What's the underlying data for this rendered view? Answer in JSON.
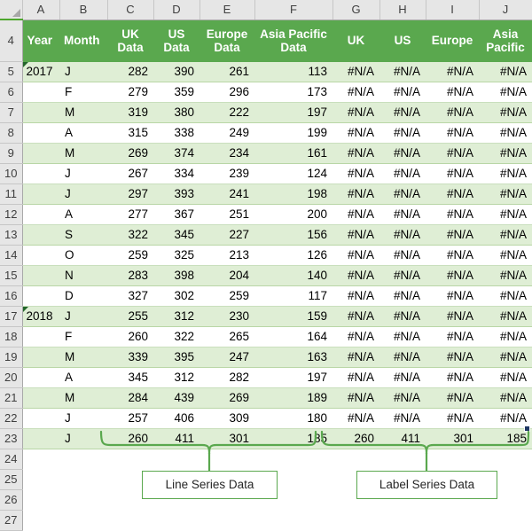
{
  "app": {
    "type": "spreadsheet",
    "column_headers": [
      "A",
      "B",
      "C",
      "D",
      "E",
      "F",
      "G",
      "H",
      "I",
      "J"
    ],
    "corner_icon": "select-all-triangle-icon"
  },
  "table": {
    "header_row_number": "4",
    "headers": [
      "Year",
      "Month",
      "UK Data",
      "US Data",
      "Europe Data",
      "Asia Pacific Data",
      "UK",
      "US",
      "Europe",
      "Asia Pacific"
    ],
    "rows": [
      {
        "row": "5",
        "year": "2017",
        "month": "J",
        "uk_data": "282",
        "us_data": "390",
        "europe_data": "261",
        "asia_data": "113",
        "uk": "#N/A",
        "us": "#N/A",
        "europe": "#N/A",
        "asia": "#N/A"
      },
      {
        "row": "6",
        "year": "",
        "month": "F",
        "uk_data": "279",
        "us_data": "359",
        "europe_data": "296",
        "asia_data": "173",
        "uk": "#N/A",
        "us": "#N/A",
        "europe": "#N/A",
        "asia": "#N/A"
      },
      {
        "row": "7",
        "year": "",
        "month": "M",
        "uk_data": "319",
        "us_data": "380",
        "europe_data": "222",
        "asia_data": "197",
        "uk": "#N/A",
        "us": "#N/A",
        "europe": "#N/A",
        "asia": "#N/A"
      },
      {
        "row": "8",
        "year": "",
        "month": "A",
        "uk_data": "315",
        "us_data": "338",
        "europe_data": "249",
        "asia_data": "199",
        "uk": "#N/A",
        "us": "#N/A",
        "europe": "#N/A",
        "asia": "#N/A"
      },
      {
        "row": "9",
        "year": "",
        "month": "M",
        "uk_data": "269",
        "us_data": "374",
        "europe_data": "234",
        "asia_data": "161",
        "uk": "#N/A",
        "us": "#N/A",
        "europe": "#N/A",
        "asia": "#N/A"
      },
      {
        "row": "10",
        "year": "",
        "month": "J",
        "uk_data": "267",
        "us_data": "334",
        "europe_data": "239",
        "asia_data": "124",
        "uk": "#N/A",
        "us": "#N/A",
        "europe": "#N/A",
        "asia": "#N/A"
      },
      {
        "row": "11",
        "year": "",
        "month": "J",
        "uk_data": "297",
        "us_data": "393",
        "europe_data": "241",
        "asia_data": "198",
        "uk": "#N/A",
        "us": "#N/A",
        "europe": "#N/A",
        "asia": "#N/A"
      },
      {
        "row": "12",
        "year": "",
        "month": "A",
        "uk_data": "277",
        "us_data": "367",
        "europe_data": "251",
        "asia_data": "200",
        "uk": "#N/A",
        "us": "#N/A",
        "europe": "#N/A",
        "asia": "#N/A"
      },
      {
        "row": "13",
        "year": "",
        "month": "S",
        "uk_data": "322",
        "us_data": "345",
        "europe_data": "227",
        "asia_data": "156",
        "uk": "#N/A",
        "us": "#N/A",
        "europe": "#N/A",
        "asia": "#N/A"
      },
      {
        "row": "14",
        "year": "",
        "month": "O",
        "uk_data": "259",
        "us_data": "325",
        "europe_data": "213",
        "asia_data": "126",
        "uk": "#N/A",
        "us": "#N/A",
        "europe": "#N/A",
        "asia": "#N/A"
      },
      {
        "row": "15",
        "year": "",
        "month": "N",
        "uk_data": "283",
        "us_data": "398",
        "europe_data": "204",
        "asia_data": "140",
        "uk": "#N/A",
        "us": "#N/A",
        "europe": "#N/A",
        "asia": "#N/A"
      },
      {
        "row": "16",
        "year": "",
        "month": "D",
        "uk_data": "327",
        "us_data": "302",
        "europe_data": "259",
        "asia_data": "117",
        "uk": "#N/A",
        "us": "#N/A",
        "europe": "#N/A",
        "asia": "#N/A"
      },
      {
        "row": "17",
        "year": "2018",
        "month": "J",
        "uk_data": "255",
        "us_data": "312",
        "europe_data": "230",
        "asia_data": "159",
        "uk": "#N/A",
        "us": "#N/A",
        "europe": "#N/A",
        "asia": "#N/A"
      },
      {
        "row": "18",
        "year": "",
        "month": "F",
        "uk_data": "260",
        "us_data": "322",
        "europe_data": "265",
        "asia_data": "164",
        "uk": "#N/A",
        "us": "#N/A",
        "europe": "#N/A",
        "asia": "#N/A"
      },
      {
        "row": "19",
        "year": "",
        "month": "M",
        "uk_data": "339",
        "us_data": "395",
        "europe_data": "247",
        "asia_data": "163",
        "uk": "#N/A",
        "us": "#N/A",
        "europe": "#N/A",
        "asia": "#N/A"
      },
      {
        "row": "20",
        "year": "",
        "month": "A",
        "uk_data": "345",
        "us_data": "312",
        "europe_data": "282",
        "asia_data": "197",
        "uk": "#N/A",
        "us": "#N/A",
        "europe": "#N/A",
        "asia": "#N/A"
      },
      {
        "row": "21",
        "year": "",
        "month": "M",
        "uk_data": "284",
        "us_data": "439",
        "europe_data": "269",
        "asia_data": "189",
        "uk": "#N/A",
        "us": "#N/A",
        "europe": "#N/A",
        "asia": "#N/A"
      },
      {
        "row": "22",
        "year": "",
        "month": "J",
        "uk_data": "257",
        "us_data": "406",
        "europe_data": "309",
        "asia_data": "180",
        "uk": "#N/A",
        "us": "#N/A",
        "europe": "#N/A",
        "asia": "#N/A"
      },
      {
        "row": "23",
        "year": "",
        "month": "J",
        "uk_data": "260",
        "us_data": "411",
        "europe_data": "301",
        "asia_data": "185",
        "uk": "260",
        "us": "411",
        "europe": "301",
        "asia": "185"
      }
    ],
    "empty_rows": [
      "24",
      "25",
      "26",
      "27"
    ]
  },
  "annotations": {
    "line_series": "Line Series Data",
    "label_series": "Label Series Data"
  },
  "colors": {
    "header_green": "#5aa84e",
    "band_green": "#dfeed5",
    "brace_green": "#5aa84e",
    "grid_line": "#c9dfbd",
    "row_header_bg": "#e6e6e6",
    "fill_handle": "#1f3864"
  }
}
